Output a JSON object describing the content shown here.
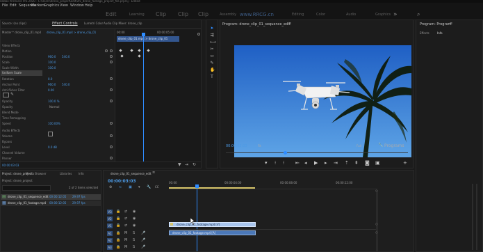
{
  "titlebar": {
    "text": "Adobe Premiere Pro 2020 - C:\\Users\\drone_project\\edit\\vfx_drone_footage_project_file.prproj - Edited"
  },
  "menu": [
    "File",
    "Edit",
    "Sequence",
    "Markers",
    "Graphics",
    "View",
    "Window",
    "Help"
  ],
  "workspaces": {
    "big": [
      "Edit",
      "Clip",
      "Clip",
      "Clip"
    ],
    "small": [
      "Learning",
      "Assembly",
      "Editing",
      "Color",
      "Effects",
      "Audio",
      "Graphics",
      "Libraries"
    ],
    "watermark": "www.RRCG.cn"
  },
  "effect_controls": {
    "tabs": [
      "Source: (no clips)",
      "Effect Controls",
      "Lumetri Color",
      "Audio Clip Mixer: drone_clip"
    ],
    "source_label": "Master * drone_clip_01.mp4",
    "clip_label": "drone_clip_01.mp4 > drone_clip_01",
    "timecodes": [
      "00:00",
      "00:00:05:00"
    ],
    "sections": [
      "Video Effects",
      "Motion",
      "Position",
      "Scale",
      "Scale Width",
      "Uniform Scale",
      "Rotation",
      "Anchor Point",
      "Anti-flicker Filter",
      "Opacity",
      "Opacity",
      "Blend Mode",
      "Time Remapping",
      "Speed",
      "Audio Effects",
      "Volume",
      "Bypass",
      "Level",
      "Channel Volume",
      "Panner",
      "Balance"
    ],
    "values": [
      "960.0",
      "540.0",
      "100.0",
      "100.0",
      "0.0",
      "960.0",
      "540.0",
      "0.00",
      "100.0 %",
      "Normal",
      "100.00%",
      "0.0 dB",
      "0.0"
    ],
    "footer_time": "00:00:03:03"
  },
  "program_monitor": {
    "title": "Program: drone_clip_01_sequence_edit",
    "timecode": "00:00:03:03",
    "fit": "Fit",
    "quality": "Full",
    "right_label": "Programs",
    "controls": [
      "marker-icon",
      "in-point-icon",
      "out-point-icon",
      "go-to-in-icon",
      "step-back-icon",
      "play-icon",
      "step-forward-icon",
      "go-to-out-icon",
      "lift-icon",
      "extract-icon",
      "export-frame-icon",
      "button-editor-icon",
      "add-icon"
    ]
  },
  "right_panel": {
    "tabs": [
      "Program: Program",
      "Effects",
      "Info"
    ]
  },
  "project_panel": {
    "tabs": [
      "Project: drone_project",
      "Media Browser",
      "Libraries",
      "Info",
      "Effects"
    ],
    "search_placeholder": "Search",
    "count_label": "2 of 2 items selected",
    "items": [
      {
        "name": "drone_clip_01_sequence_edit",
        "meta": "00:00:12:05",
        "fps": "29.97 fps"
      },
      {
        "name": "drone_clip_01_footage.mp4",
        "meta": "00:00:12:05",
        "fps": "29.97 fps"
      }
    ]
  },
  "timeline": {
    "title": "drone_clip_01_sequence_edit",
    "timecode": "00:00:03:03",
    "ruler": [
      "00:00",
      "00:00:04:00",
      "00:00:08:00",
      "00:00:12:00"
    ],
    "tracks": [
      "V3",
      "V2",
      "V1",
      "A1",
      "A2",
      "A3"
    ],
    "clips": [
      "drone_clip_01_footage.mp4 [V]",
      "drone_clip_01_footage.mp4 [A]"
    ]
  },
  "colors": {
    "accent": "#2e8cff",
    "clip_video": "#a9c6ee",
    "clip_audio": "#4b78b8",
    "work_area": "#d8c56a"
  }
}
